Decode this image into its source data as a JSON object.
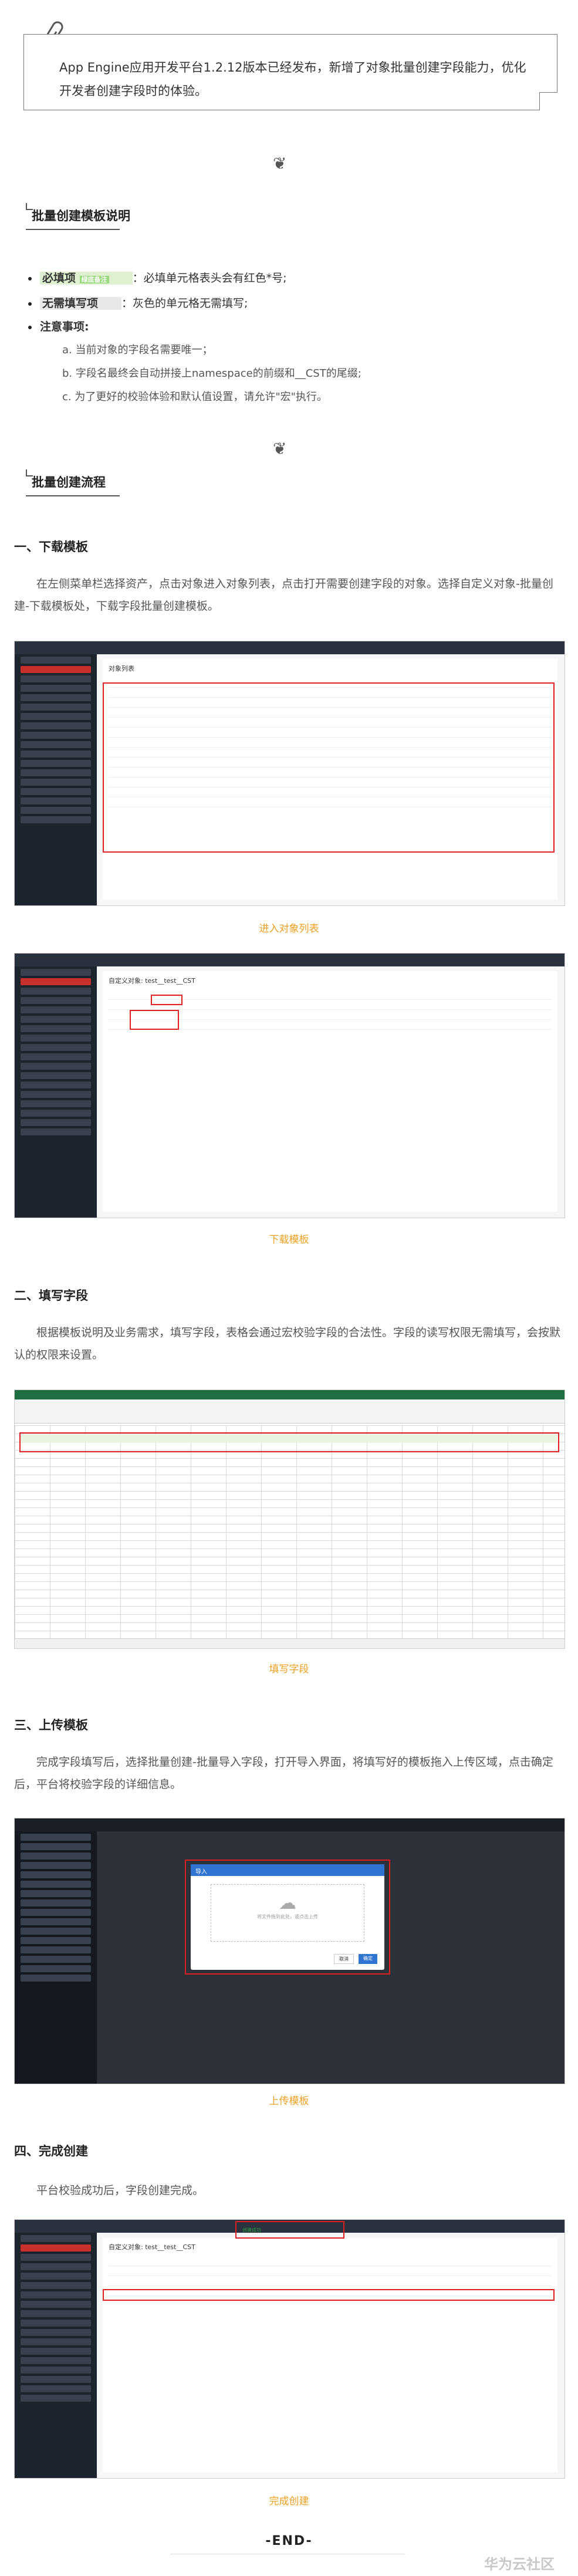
{
  "intro": {
    "text": "App Engine应用开发平台1.2.12版本已经发布，新增了对象批量创建字段能力，优化开发者创建字段时的体验。"
  },
  "section1": {
    "title": "批量创建模板说明",
    "bullets": [
      {
        "label": "必填项",
        "badge": "绿底备注",
        "desc": "：必填单元格表头会有红色*号;"
      },
      {
        "label": "无需填写项",
        "desc": "：灰色的单元格无需填写;"
      },
      {
        "label": "注意事项:"
      }
    ],
    "notes": [
      "a. 当前对象的字段名需要唯一；",
      "b. 字段名最终会自动拼接上namespace的前缀和__CST的尾缀;",
      "c. 为了更好的校验体验和默认值设置，请允许\"宏\"执行。"
    ]
  },
  "section2": {
    "title": "批量创建流程"
  },
  "steps": [
    {
      "title": "一、下载模板",
      "para": "在左侧菜单栏选择资产，点击对象进入对象列表，点击打开需要创建字段的对象。选择自定义对象-批量创建-下载模板处，下载字段批量创建模板。",
      "captions": [
        "进入对象列表",
        "下载模板"
      ]
    },
    {
      "title": "二、填写字段",
      "para": "根据模板说明及业务需求，填写字段，表格会通过宏校验字段的合法性。字段的读写权限无需填写，会按默认的权限来设置。",
      "captions": [
        "填写字段"
      ]
    },
    {
      "title": "三、上传模板",
      "para": "完成字段填写后，选择批量创建-批量导入字段，打开导入界面，将填写好的模板拖入上传区域，点击确定后，平台将校验字段的详细信息。",
      "captions": [
        "上传模板"
      ]
    },
    {
      "title": "四、完成创建",
      "para": "平台校验成功后，字段创建完成。",
      "captions": [
        "完成创建"
      ]
    }
  ],
  "screens": {
    "object_list_title": "对象列表",
    "custom_object_title": "自定义对象: test__test__CST",
    "upload_dialog_title": "导入",
    "upload_hint": "将文件拖到此处，或点击上传",
    "confirm": "确定",
    "cancel": "取消",
    "success_toast": "创建成功"
  },
  "end": "-END-",
  "brand": "华为云社区",
  "colors": {
    "accent_red": "#e02020",
    "caption_orange": "#f0a020",
    "highlight_green": "#dff0d0"
  }
}
